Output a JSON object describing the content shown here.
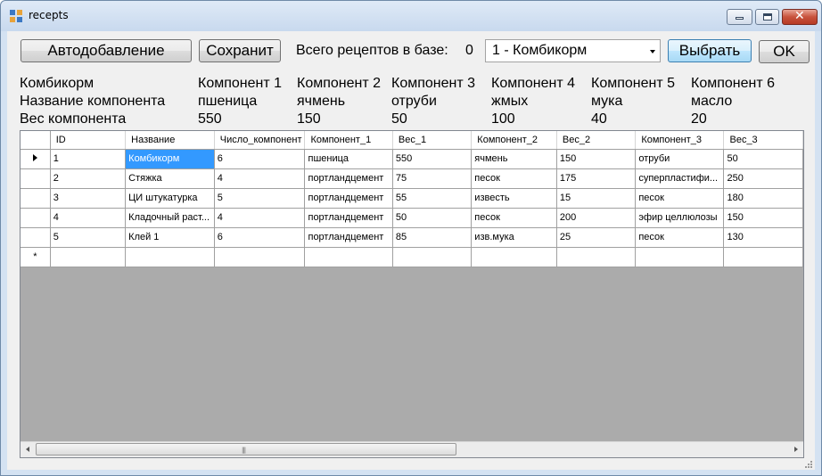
{
  "window": {
    "title": "recepts"
  },
  "toolbar": {
    "autoadd_label": "Автодобавление",
    "save_label": "Сохранит",
    "total_label": "Всего рецептов в базе:",
    "total_value": "0",
    "recipe_select_value": "1 - Комбикорм",
    "choose_label": "Выбрать",
    "ok_label": "OK"
  },
  "info": {
    "recipe_name": "Комбикорм",
    "name_row_label": "Название компонента",
    "weight_row_label": "Вес компонента",
    "components": [
      {
        "header": "Компонент 1",
        "name": "пшеница",
        "weight": "550"
      },
      {
        "header": "Компонент 2",
        "name": "ячмень",
        "weight": "150"
      },
      {
        "header": "Компонент 3",
        "name": "отруби",
        "weight": "50"
      },
      {
        "header": "Компонент 4",
        "name": "жмых",
        "weight": "100"
      },
      {
        "header": "Компонент 5",
        "name": "мука",
        "weight": "40"
      },
      {
        "header": "Компонент 6",
        "name": "масло",
        "weight": "20"
      }
    ]
  },
  "grid": {
    "columns": [
      "ID",
      "Название",
      "Число_компонент",
      "Компонент_1",
      "Вес_1",
      "Компонент_2",
      "Вес_2",
      "Компонент_3",
      "Вес_3"
    ],
    "rows": [
      [
        "1",
        "Комбикорм",
        "6",
        "пшеница",
        "550",
        "ячмень",
        "150",
        "отруби",
        "50"
      ],
      [
        "2",
        "Стяжка",
        "4",
        "портландцемент",
        "75",
        "песок",
        "175",
        "суперпластифи...",
        "250"
      ],
      [
        "3",
        "ЦИ штукатурка",
        "5",
        "портландцемент",
        "55",
        "известь",
        "15",
        "песок",
        "180"
      ],
      [
        "4",
        "Кладочный раст...",
        "4",
        "портландцемент",
        "50",
        "песок",
        "200",
        "эфир целлюлозы",
        "150"
      ],
      [
        "5",
        "Клей 1",
        "6",
        "портландцемент",
        "85",
        "изв.мука",
        "25",
        "песок",
        "130"
      ]
    ],
    "new_row_marker": "*",
    "scroll_grip": "|||"
  },
  "colors": {
    "selection": "#3399ff",
    "empty_area": "#ababab",
    "client_bg": "#f0f0f0"
  }
}
